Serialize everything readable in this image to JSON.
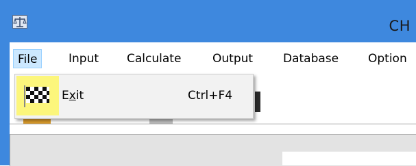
{
  "window": {
    "title": "CH"
  },
  "menubar": {
    "items": [
      {
        "label": "File",
        "active": true
      },
      {
        "label": "Input"
      },
      {
        "label": "Calculate"
      },
      {
        "label": "Output"
      },
      {
        "label": "Database"
      },
      {
        "label": "Option"
      }
    ]
  },
  "file_menu": {
    "items": [
      {
        "label_first": "E",
        "label_mnemonic": "x",
        "label_rest": "it",
        "shortcut": "Ctrl+F4",
        "icon": "checkered-flag-icon"
      }
    ]
  },
  "colors": {
    "titlebar": "#3e88de",
    "menu_active": "#cce8ff",
    "icon_highlight": "#fcf67c"
  }
}
